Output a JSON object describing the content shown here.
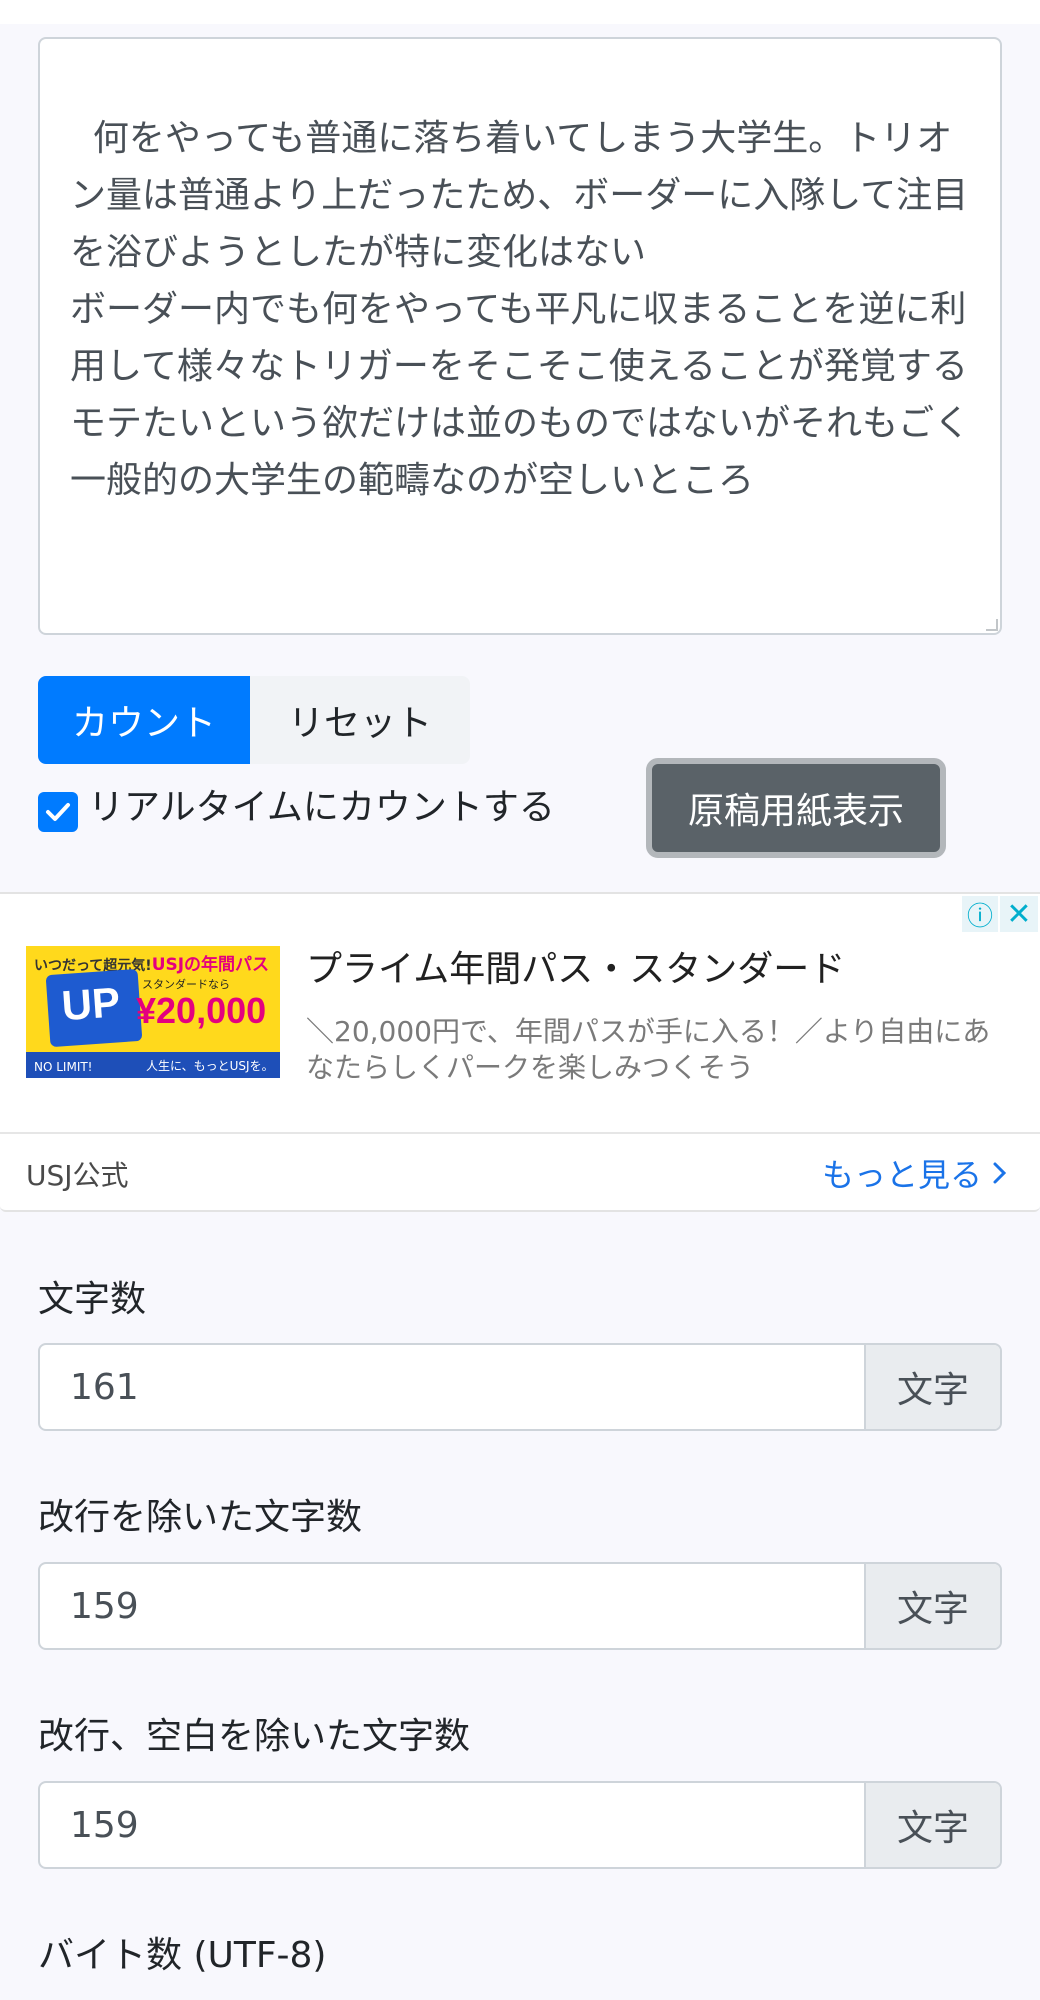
{
  "textarea": {
    "content": "何をやっても普通に落ち着いてしまう大学生。トリオン量は普通より上だったため、ボーダーに入隊して注目を浴びようとしたが特に変化はない\nボーダー内でも何をやっても平凡に収まることを逆に利用して様々なトリガーをそこそこ使えることが発覚する\nモテたいという欲だけは並のものではないがそれもごく一般的の大学生の範疇なのが空しいところ"
  },
  "buttons": {
    "count": "カウント",
    "reset": "リセット",
    "genko": "原稿用紙表示"
  },
  "realtime": {
    "label": "リアルタイムにカウントする",
    "checked": true
  },
  "ad": {
    "image": {
      "top_text": "いつだって超元気!",
      "top_brand": "USJの年間パス",
      "small_text": "スタンダードなら",
      "price": "¥20,000",
      "bottom_left": "NO LIMIT!",
      "bottom_right": "人生に、もっとUSJを。"
    },
    "title": "プライム年間パス・スタンダード",
    "description": "＼20,000円で、年間パスが手に入る！／より自由にあなたらしくパークを楽しみつくそう",
    "advertiser": "USJ公式",
    "more": "もっと見る"
  },
  "stats": {
    "chars": {
      "label": "文字数",
      "value": "161",
      "unit": "文字"
    },
    "no_newline": {
      "label": "改行を除いた文字数",
      "value": "159",
      "unit": "文字"
    },
    "no_space": {
      "label": "改行、空白を除いた文字数",
      "value": "159",
      "unit": "文字"
    },
    "bytes": {
      "label": "バイト数 (UTF-8)"
    }
  }
}
